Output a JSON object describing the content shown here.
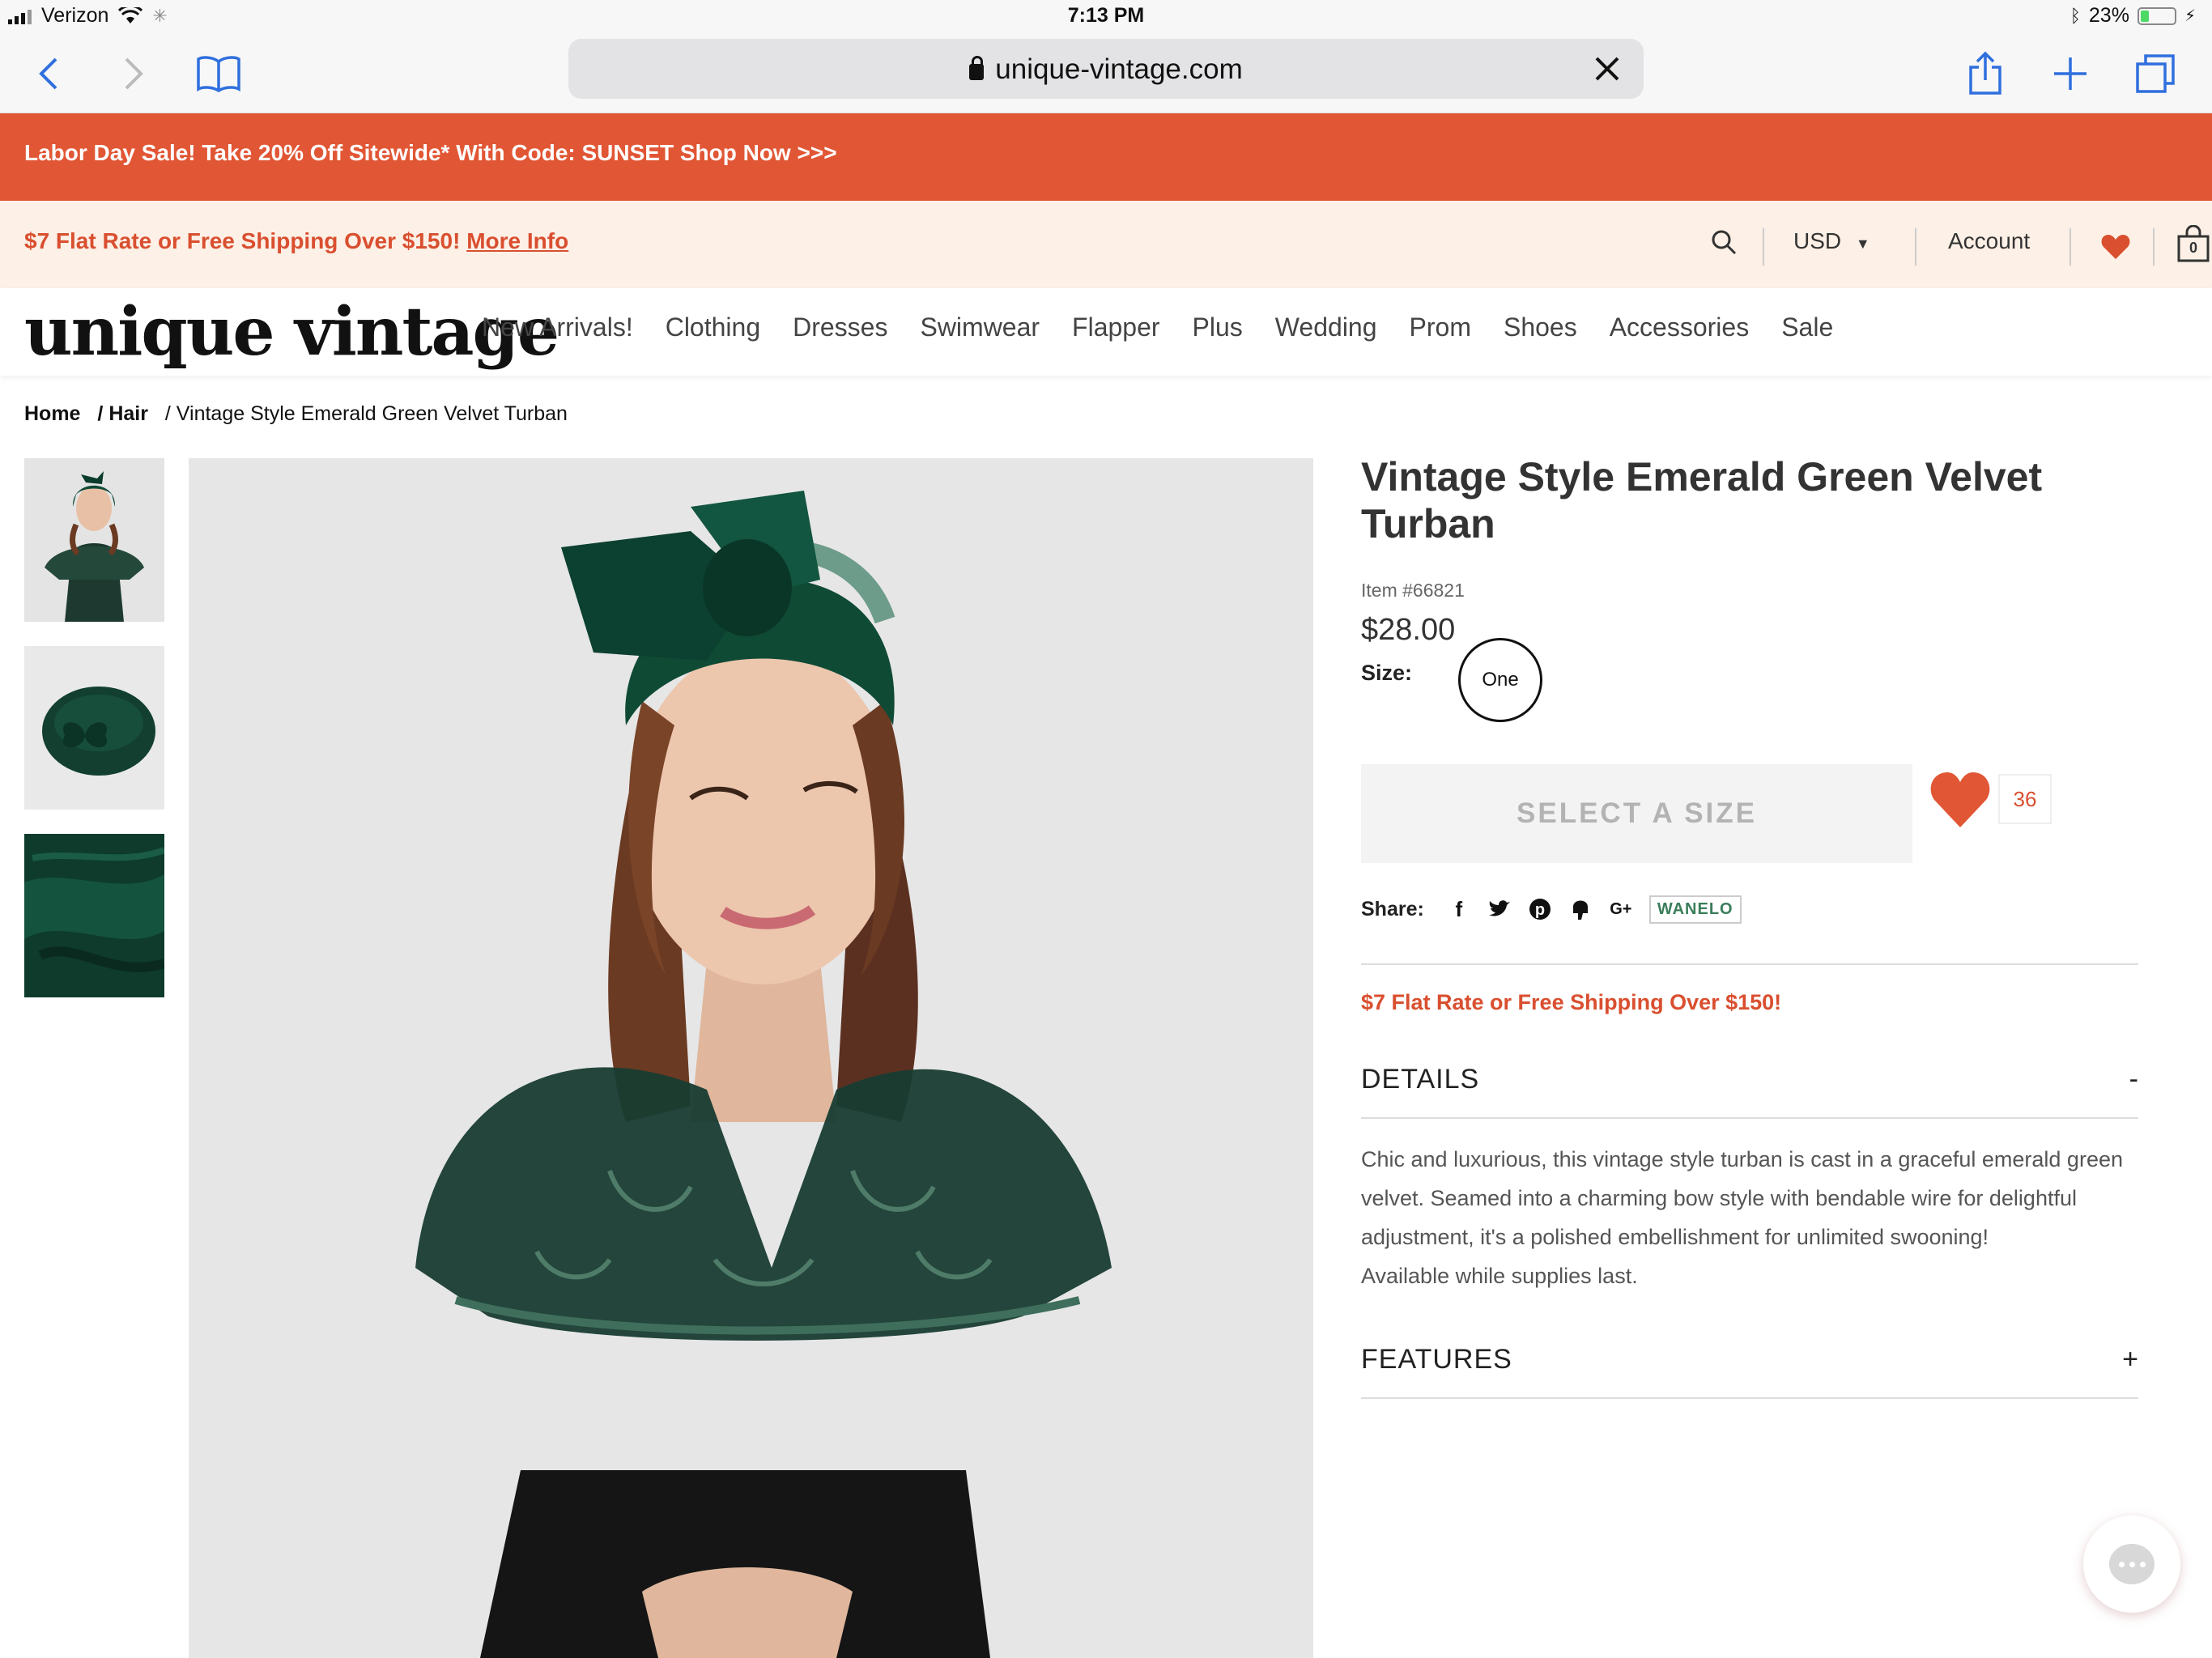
{
  "status_bar": {
    "carrier": "Verizon",
    "time": "7:13 PM",
    "battery_percent": "23%",
    "battery_level": 0.23
  },
  "browser": {
    "url": "unique-vintage.com"
  },
  "promo_banner": {
    "text": "Labor Day Sale! Take 20% Off Sitewide* With Code: SUNSET Shop Now >>>",
    "bg_color": "#e15634"
  },
  "shipping_bar": {
    "text": "$7 Flat Rate or Free Shipping Over $150!",
    "link": "More Info",
    "currency": "USD",
    "account": "Account",
    "cart_count": "0"
  },
  "nav": {
    "logo": "unique vintage",
    "links": [
      "New Arrivals!",
      "Clothing",
      "Dresses",
      "Swimwear",
      "Flapper",
      "Plus",
      "Wedding",
      "Prom",
      "Shoes",
      "Accessories",
      "Sale"
    ]
  },
  "breadcrumb": {
    "items": [
      "Home",
      "/ Hair",
      "/ Vintage Style Emerald Green Velvet Turban"
    ]
  },
  "product": {
    "title": "Vintage Style Emerald Green Velvet Turban",
    "item_number": "Item #66821",
    "price": "$28.00",
    "size_label": "Size:",
    "size_option": "One",
    "select_button": "SELECT A SIZE",
    "favorites_count": "36",
    "share_label": "Share:",
    "share_wanelo": "WANELO",
    "shipping_note": "$7 Flat Rate or Free Shipping Over $150!",
    "details_title": "DETAILS",
    "details_toggle": "-",
    "details_lines": [
      "Chic and luxurious, this vintage style turban is cast in a graceful emerald green",
      "velvet. Seamed into a charming bow style with bendable wire for delightful",
      "adjustment, it's a polished embellishment for unlimited swooning!",
      "Available while supplies last."
    ],
    "features_title": "FEATURES",
    "features_toggle": "+"
  },
  "colors": {
    "accent": "#d94f2f",
    "velvet_green": "#0f4a35"
  }
}
